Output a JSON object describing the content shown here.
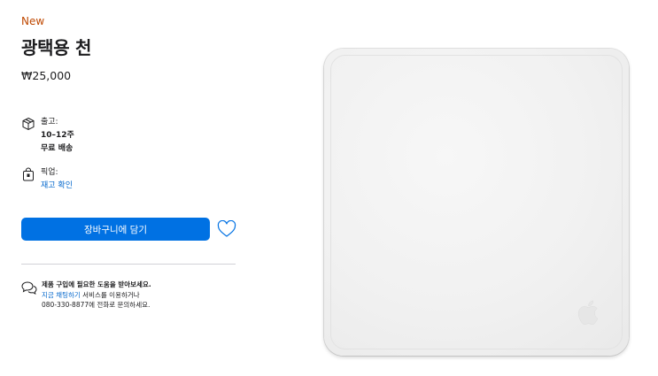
{
  "product": {
    "eyebrow": "New",
    "title": "광택용 천",
    "price": "₩25,000"
  },
  "shipping": {
    "label": "출고:",
    "time": "10–12주",
    "method": "무료 배송"
  },
  "pickup": {
    "label": "픽업:",
    "link": "재고 확인"
  },
  "actions": {
    "add_to_bag": "장바구니에 담기"
  },
  "help": {
    "title": "제품 구입에 필요한 도움을 받아보세요.",
    "chat_link": "지금 채팅하기",
    "chat_suffix": " 서비스를 이용하거나",
    "phone_line": "080-330-8877에 전화로 문의하세요."
  },
  "colors": {
    "eyebrow": "#bf4800",
    "button": "#0071e3",
    "link": "#0066cc"
  },
  "icons": [
    "box-icon",
    "bag-icon",
    "heart-icon",
    "chat-bubbles-icon",
    "apple-logo-icon"
  ]
}
